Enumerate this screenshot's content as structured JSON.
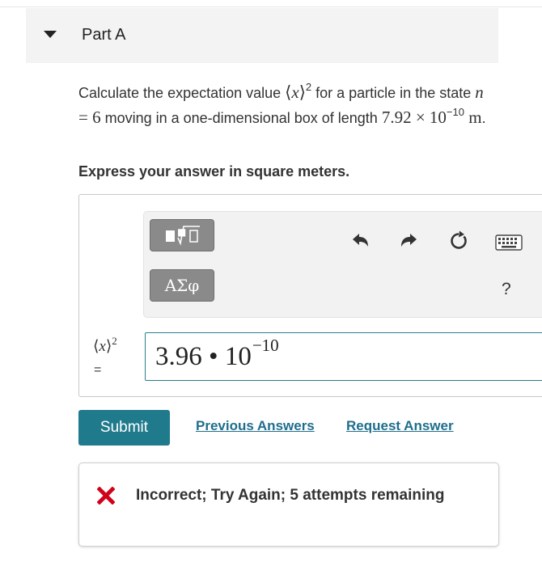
{
  "part": {
    "title": "Part A",
    "toggle_icon": "triangle-down-icon"
  },
  "question": {
    "text_1": "Calculate the expectation value ",
    "math_bra": "⟨",
    "math_var": "x",
    "math_ket": "⟩",
    "math_exp": "2",
    "text_2": " for a particle in the state ",
    "math_n": "n",
    "math_eq": " = 6",
    "text_3": " moving in a one-dimensional box of length ",
    "length_mantissa": "7.92 × 10",
    "length_exp": "−10",
    "length_unit": " m",
    "text_4": "."
  },
  "instruction": "Express your answer in square meters.",
  "toolbar": {
    "templates_icon": "templates-icon",
    "greek_label": "ΑΣφ",
    "undo_icon": "undo-icon",
    "redo_icon": "redo-icon",
    "reset_icon": "reset-icon",
    "keyboard_icon": "keyboard-icon",
    "help_label": "?"
  },
  "answer": {
    "var_bra": "⟨",
    "var_x": "x",
    "var_ket": "⟩",
    "var_exp": "2",
    "var_equals": "=",
    "mantissa": "3.96",
    "dot": " • ",
    "base": "10",
    "exponent": "−10"
  },
  "actions": {
    "submit_label": "Submit",
    "previous_answers_label": "Previous Answers",
    "request_answer_label": "Request Answer"
  },
  "feedback": {
    "icon": "x-mark-icon",
    "icon_color": "#d0021b",
    "message": "Incorrect; Try Again; 5 attempts remaining"
  },
  "colors": {
    "accent": "#1f7a8c",
    "link": "#1f6e8c"
  }
}
